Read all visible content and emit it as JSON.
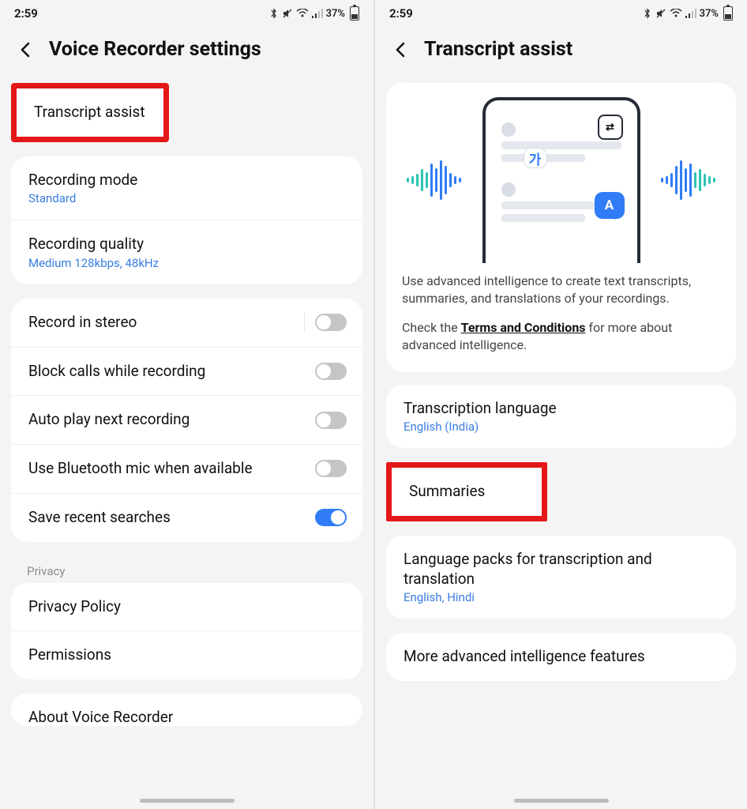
{
  "status": {
    "time": "2:59",
    "battery": "37%"
  },
  "left": {
    "title": "Voice Recorder settings",
    "transcript_assist": "Transcript assist",
    "recording_mode": {
      "label": "Recording mode",
      "value": "Standard"
    },
    "recording_quality": {
      "label": "Recording quality",
      "value": "Medium 128kbps, 48kHz"
    },
    "toggles": {
      "stereo": "Record in stereo",
      "block_calls": "Block calls while recording",
      "autoplay": "Auto play next recording",
      "bt_mic": "Use Bluetooth mic when available",
      "save_search": "Save recent searches"
    },
    "privacy_label": "Privacy",
    "privacy_policy": "Privacy Policy",
    "permissions": "Permissions",
    "about": "About Voice Recorder"
  },
  "right": {
    "title": "Transcript assist",
    "desc1": "Use advanced intelligence to create text transcripts, summaries, and translations of your recordings.",
    "desc2_pre": "Check the ",
    "desc2_link": "Terms and Conditions",
    "desc2_post": " for more about advanced intelligence.",
    "trans_lang": {
      "label": "Transcription language",
      "value": "English (India)"
    },
    "summaries": "Summaries",
    "lang_packs": {
      "label": "Language packs for transcription and translation",
      "value": "English, Hindi"
    },
    "more": "More advanced intelligence features",
    "bubble_ko": "가",
    "bubble_a": "A",
    "tr_icon_label": "⇄"
  }
}
